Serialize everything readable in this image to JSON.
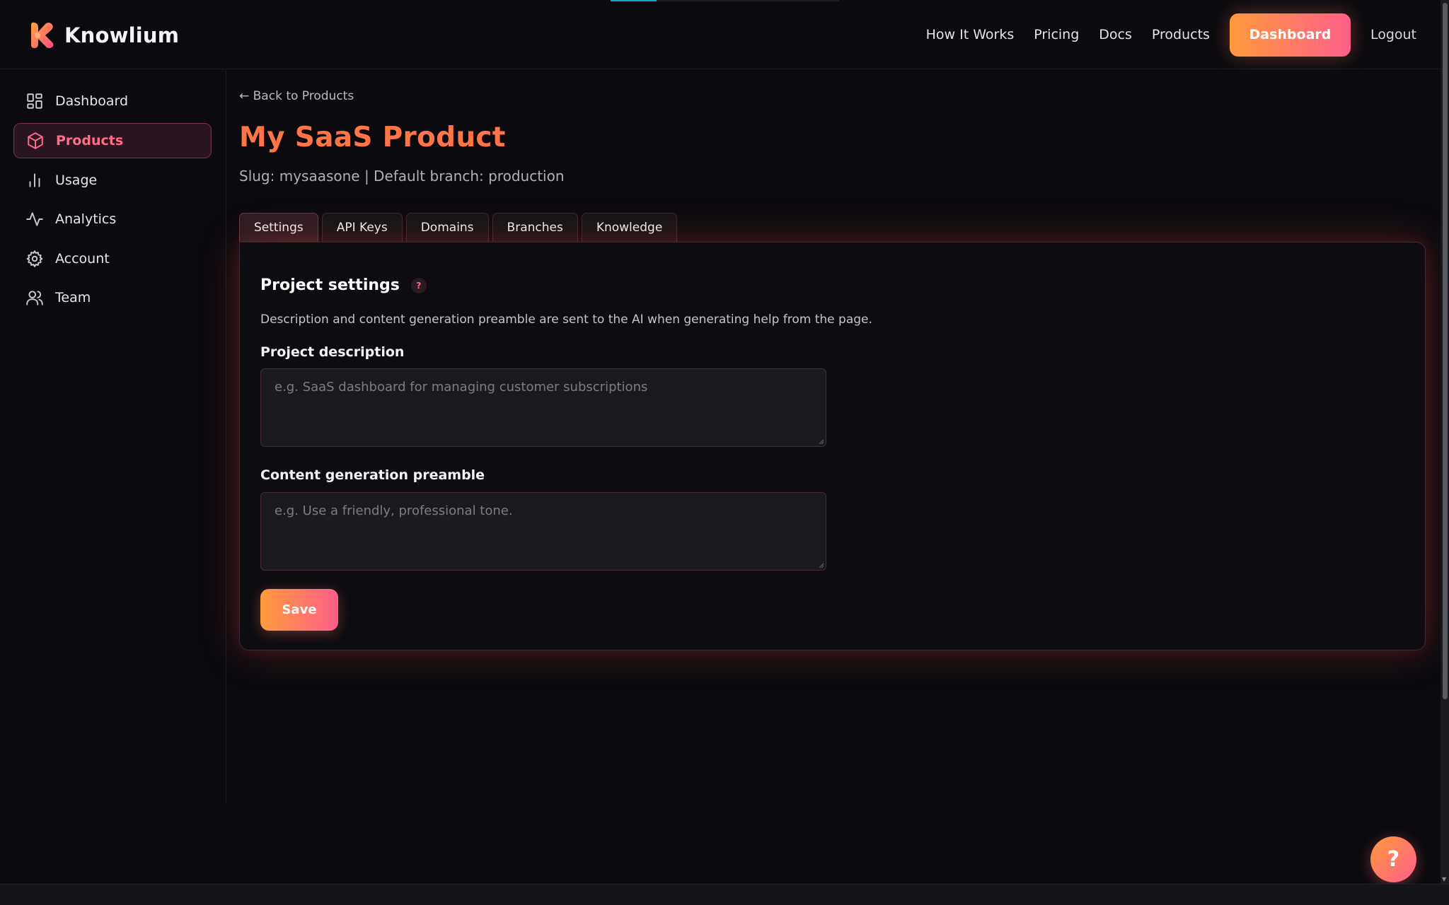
{
  "app": {
    "name": "Knowlium"
  },
  "top_nav": {
    "items": [
      "How It Works",
      "Pricing",
      "Docs",
      "Products"
    ],
    "dashboard_label": "Dashboard",
    "logout_label": "Logout"
  },
  "sidebar": {
    "items": [
      {
        "label": "Dashboard",
        "icon": "dashboard-icon"
      },
      {
        "label": "Products",
        "icon": "box-icon",
        "active": true
      },
      {
        "label": "Usage",
        "icon": "bar-chart-icon"
      },
      {
        "label": "Analytics",
        "icon": "activity-icon"
      },
      {
        "label": "Account",
        "icon": "gear-icon"
      },
      {
        "label": "Team",
        "icon": "users-icon"
      }
    ]
  },
  "page": {
    "back_link": "← Back to Products",
    "title": "My SaaS Product",
    "meta": "Slug: mysaasone | Default branch: production",
    "tabs": [
      "Settings",
      "API Keys",
      "Domains",
      "Branches",
      "Knowledge"
    ],
    "active_tab": "Settings"
  },
  "settings": {
    "title": "Project settings",
    "help": "?",
    "description": "Description and content generation preamble are sent to the AI when generating help from the page.",
    "project_description_label": "Project description",
    "project_description_placeholder": "e.g. SaaS dashboard for managing customer subscriptions",
    "project_description_value": "",
    "preamble_label": "Content generation preamble",
    "preamble_placeholder": "e.g. Use a friendly, professional tone.",
    "preamble_value": "",
    "save_label": "Save"
  },
  "fab": {
    "label": "?"
  },
  "colors": {
    "accent_orange": "#ff7548",
    "accent_pink": "#ff6d8a",
    "gradient_start": "#ff9a3c",
    "gradient_end": "#ff5f8a",
    "background": "#0a0a0f"
  }
}
